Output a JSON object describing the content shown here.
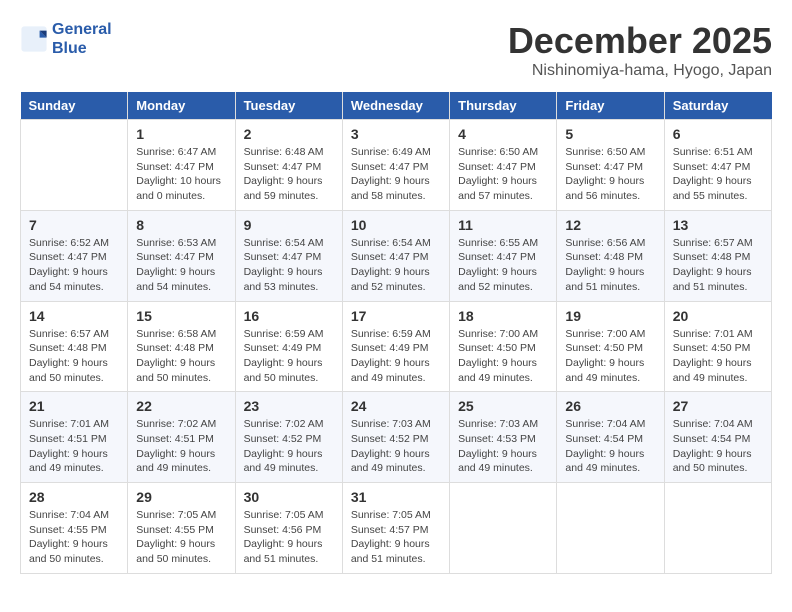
{
  "logo": {
    "line1": "General",
    "line2": "Blue"
  },
  "title": {
    "month": "December 2025",
    "location": "Nishinomiya-hama, Hyogo, Japan"
  },
  "days_of_week": [
    "Sunday",
    "Monday",
    "Tuesday",
    "Wednesday",
    "Thursday",
    "Friday",
    "Saturday"
  ],
  "weeks": [
    [
      {
        "day": "",
        "info": ""
      },
      {
        "day": "1",
        "info": "Sunrise: 6:47 AM\nSunset: 4:47 PM\nDaylight: 10 hours\nand 0 minutes."
      },
      {
        "day": "2",
        "info": "Sunrise: 6:48 AM\nSunset: 4:47 PM\nDaylight: 9 hours\nand 59 minutes."
      },
      {
        "day": "3",
        "info": "Sunrise: 6:49 AM\nSunset: 4:47 PM\nDaylight: 9 hours\nand 58 minutes."
      },
      {
        "day": "4",
        "info": "Sunrise: 6:50 AM\nSunset: 4:47 PM\nDaylight: 9 hours\nand 57 minutes."
      },
      {
        "day": "5",
        "info": "Sunrise: 6:50 AM\nSunset: 4:47 PM\nDaylight: 9 hours\nand 56 minutes."
      },
      {
        "day": "6",
        "info": "Sunrise: 6:51 AM\nSunset: 4:47 PM\nDaylight: 9 hours\nand 55 minutes."
      }
    ],
    [
      {
        "day": "7",
        "info": "Sunrise: 6:52 AM\nSunset: 4:47 PM\nDaylight: 9 hours\nand 54 minutes."
      },
      {
        "day": "8",
        "info": "Sunrise: 6:53 AM\nSunset: 4:47 PM\nDaylight: 9 hours\nand 54 minutes."
      },
      {
        "day": "9",
        "info": "Sunrise: 6:54 AM\nSunset: 4:47 PM\nDaylight: 9 hours\nand 53 minutes."
      },
      {
        "day": "10",
        "info": "Sunrise: 6:54 AM\nSunset: 4:47 PM\nDaylight: 9 hours\nand 52 minutes."
      },
      {
        "day": "11",
        "info": "Sunrise: 6:55 AM\nSunset: 4:47 PM\nDaylight: 9 hours\nand 52 minutes."
      },
      {
        "day": "12",
        "info": "Sunrise: 6:56 AM\nSunset: 4:48 PM\nDaylight: 9 hours\nand 51 minutes."
      },
      {
        "day": "13",
        "info": "Sunrise: 6:57 AM\nSunset: 4:48 PM\nDaylight: 9 hours\nand 51 minutes."
      }
    ],
    [
      {
        "day": "14",
        "info": "Sunrise: 6:57 AM\nSunset: 4:48 PM\nDaylight: 9 hours\nand 50 minutes."
      },
      {
        "day": "15",
        "info": "Sunrise: 6:58 AM\nSunset: 4:48 PM\nDaylight: 9 hours\nand 50 minutes."
      },
      {
        "day": "16",
        "info": "Sunrise: 6:59 AM\nSunset: 4:49 PM\nDaylight: 9 hours\nand 50 minutes."
      },
      {
        "day": "17",
        "info": "Sunrise: 6:59 AM\nSunset: 4:49 PM\nDaylight: 9 hours\nand 49 minutes."
      },
      {
        "day": "18",
        "info": "Sunrise: 7:00 AM\nSunset: 4:50 PM\nDaylight: 9 hours\nand 49 minutes."
      },
      {
        "day": "19",
        "info": "Sunrise: 7:00 AM\nSunset: 4:50 PM\nDaylight: 9 hours\nand 49 minutes."
      },
      {
        "day": "20",
        "info": "Sunrise: 7:01 AM\nSunset: 4:50 PM\nDaylight: 9 hours\nand 49 minutes."
      }
    ],
    [
      {
        "day": "21",
        "info": "Sunrise: 7:01 AM\nSunset: 4:51 PM\nDaylight: 9 hours\nand 49 minutes."
      },
      {
        "day": "22",
        "info": "Sunrise: 7:02 AM\nSunset: 4:51 PM\nDaylight: 9 hours\nand 49 minutes."
      },
      {
        "day": "23",
        "info": "Sunrise: 7:02 AM\nSunset: 4:52 PM\nDaylight: 9 hours\nand 49 minutes."
      },
      {
        "day": "24",
        "info": "Sunrise: 7:03 AM\nSunset: 4:52 PM\nDaylight: 9 hours\nand 49 minutes."
      },
      {
        "day": "25",
        "info": "Sunrise: 7:03 AM\nSunset: 4:53 PM\nDaylight: 9 hours\nand 49 minutes."
      },
      {
        "day": "26",
        "info": "Sunrise: 7:04 AM\nSunset: 4:54 PM\nDaylight: 9 hours\nand 49 minutes."
      },
      {
        "day": "27",
        "info": "Sunrise: 7:04 AM\nSunset: 4:54 PM\nDaylight: 9 hours\nand 50 minutes."
      }
    ],
    [
      {
        "day": "28",
        "info": "Sunrise: 7:04 AM\nSunset: 4:55 PM\nDaylight: 9 hours\nand 50 minutes."
      },
      {
        "day": "29",
        "info": "Sunrise: 7:05 AM\nSunset: 4:55 PM\nDaylight: 9 hours\nand 50 minutes."
      },
      {
        "day": "30",
        "info": "Sunrise: 7:05 AM\nSunset: 4:56 PM\nDaylight: 9 hours\nand 51 minutes."
      },
      {
        "day": "31",
        "info": "Sunrise: 7:05 AM\nSunset: 4:57 PM\nDaylight: 9 hours\nand 51 minutes."
      },
      {
        "day": "",
        "info": ""
      },
      {
        "day": "",
        "info": ""
      },
      {
        "day": "",
        "info": ""
      }
    ]
  ]
}
